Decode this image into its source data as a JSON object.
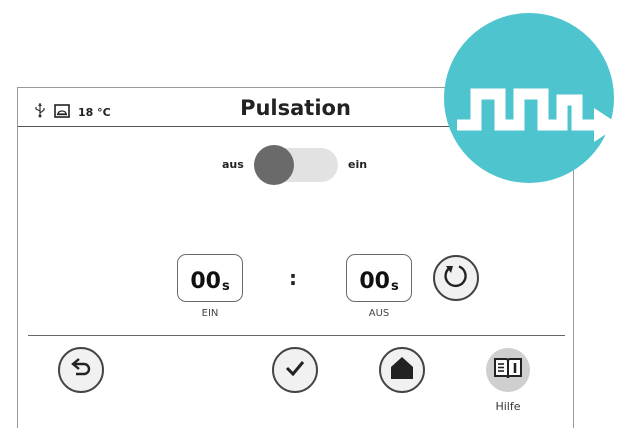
{
  "status": {
    "temperature": "18 °C",
    "icons": [
      "usb-icon",
      "image-icon"
    ]
  },
  "title": "Pulsation",
  "toggle": {
    "off_label": "aus",
    "on_label": "ein",
    "state": "off"
  },
  "timers": {
    "ein": {
      "value": "00",
      "unit": "s",
      "label": "EIN"
    },
    "aus": {
      "value": "00",
      "unit": "s",
      "label": "AUS"
    },
    "separator": ":"
  },
  "toolbar": {
    "help_label": "Hilfe"
  },
  "colors": {
    "accent": "#4ec4cf",
    "knob": "#6a6a6a",
    "track": "#e2e2e2",
    "button_fill": "#f1f1f1"
  }
}
